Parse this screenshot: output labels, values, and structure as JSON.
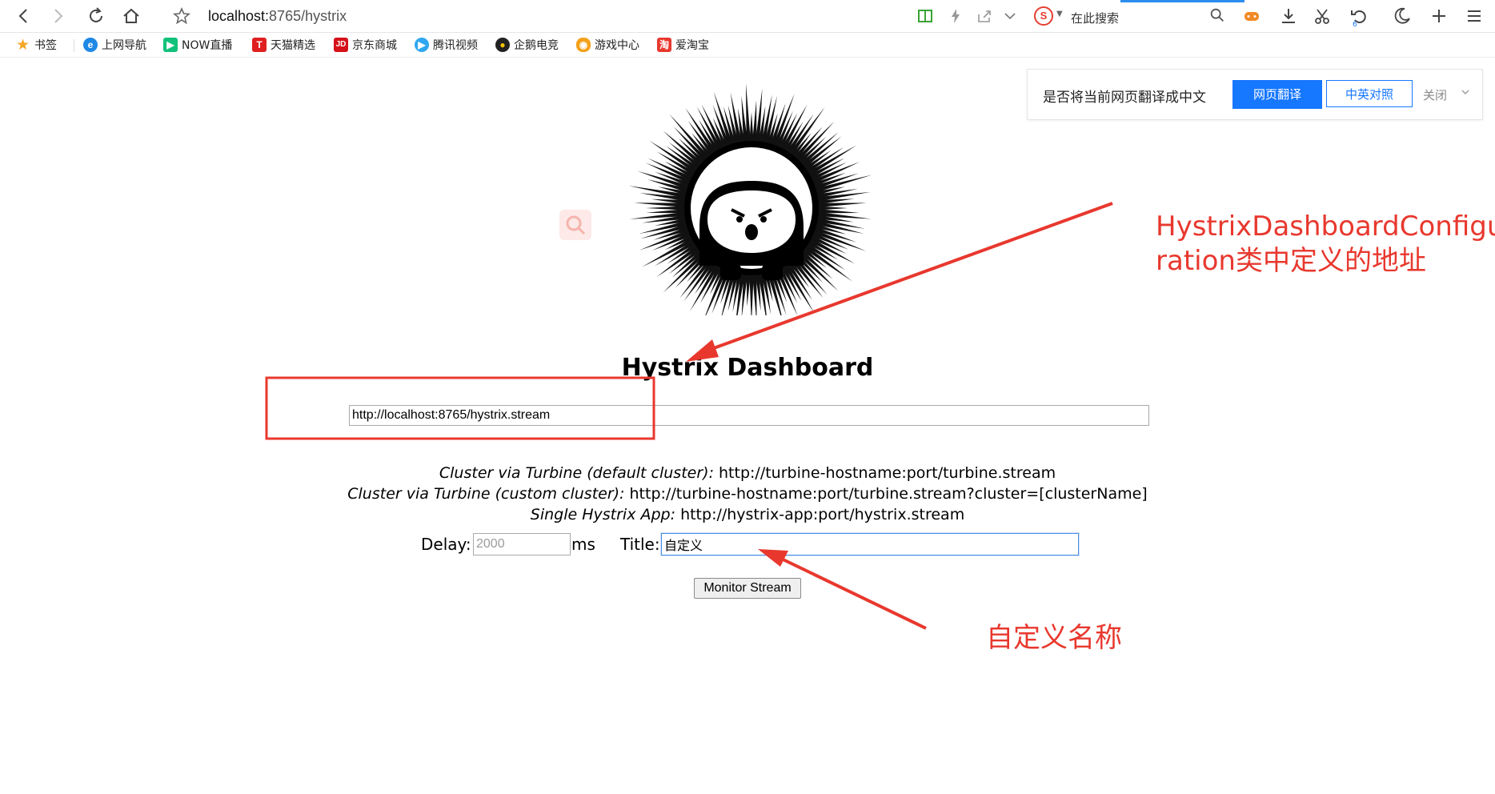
{
  "browser": {
    "address_host": "localhost:",
    "address_path": "8765/hystrix",
    "search_placeholder": "在此搜索",
    "reload_badge": "6"
  },
  "bookmarks": [
    {
      "label": "书签",
      "icon": "star-icon",
      "color": "#f5a623"
    },
    {
      "label": "上网导航",
      "icon": "ie-icon",
      "color": "#1e88e5"
    },
    {
      "label": "NOW直播",
      "icon": "now-icon",
      "color": "#12c27a"
    },
    {
      "label": "天猫精选",
      "icon": "tmall-icon",
      "color": "#e02020"
    },
    {
      "label": "京东商城",
      "icon": "jd-icon",
      "color": "#d5121a"
    },
    {
      "label": "腾讯视频",
      "icon": "tencent-video-icon",
      "color": "#30a7f0"
    },
    {
      "label": "企鹅电竞",
      "icon": "penguin-icon",
      "color": "#222222"
    },
    {
      "label": "游戏中心",
      "icon": "gamepad-icon",
      "color": "#f3a11a"
    },
    {
      "label": "爱淘宝",
      "icon": "taobao-icon",
      "color": "#e8382e"
    }
  ],
  "translate_bar": {
    "question": "是否将当前网页翻译成中文",
    "translate_button": "网页翻译",
    "compare_button": "中英对照",
    "close": "关闭"
  },
  "page": {
    "title": "Hystrix Dashboard",
    "stream_url": "http://localhost:8765/hystrix.stream",
    "hints": [
      {
        "label": "Cluster via Turbine (default cluster):",
        "value": "http://turbine-hostname:port/turbine.stream"
      },
      {
        "label": "Cluster via Turbine (custom cluster):",
        "value": "http://turbine-hostname:port/turbine.stream?cluster=[clusterName]"
      },
      {
        "label": "Single Hystrix App:",
        "value": "http://hystrix-app:port/hystrix.stream"
      }
    ],
    "delay_label": "Delay:",
    "delay_placeholder": "2000",
    "delay_unit": "ms",
    "title_label": "Title:",
    "title_value": "自定义",
    "monitor_button": "Monitor Stream"
  },
  "annotations": {
    "note_config_line1": "HystrixDashboardConfigu",
    "note_config_line2": "ration类中定义的地址",
    "note_title": "自定义名称",
    "color": "#e8382e"
  }
}
